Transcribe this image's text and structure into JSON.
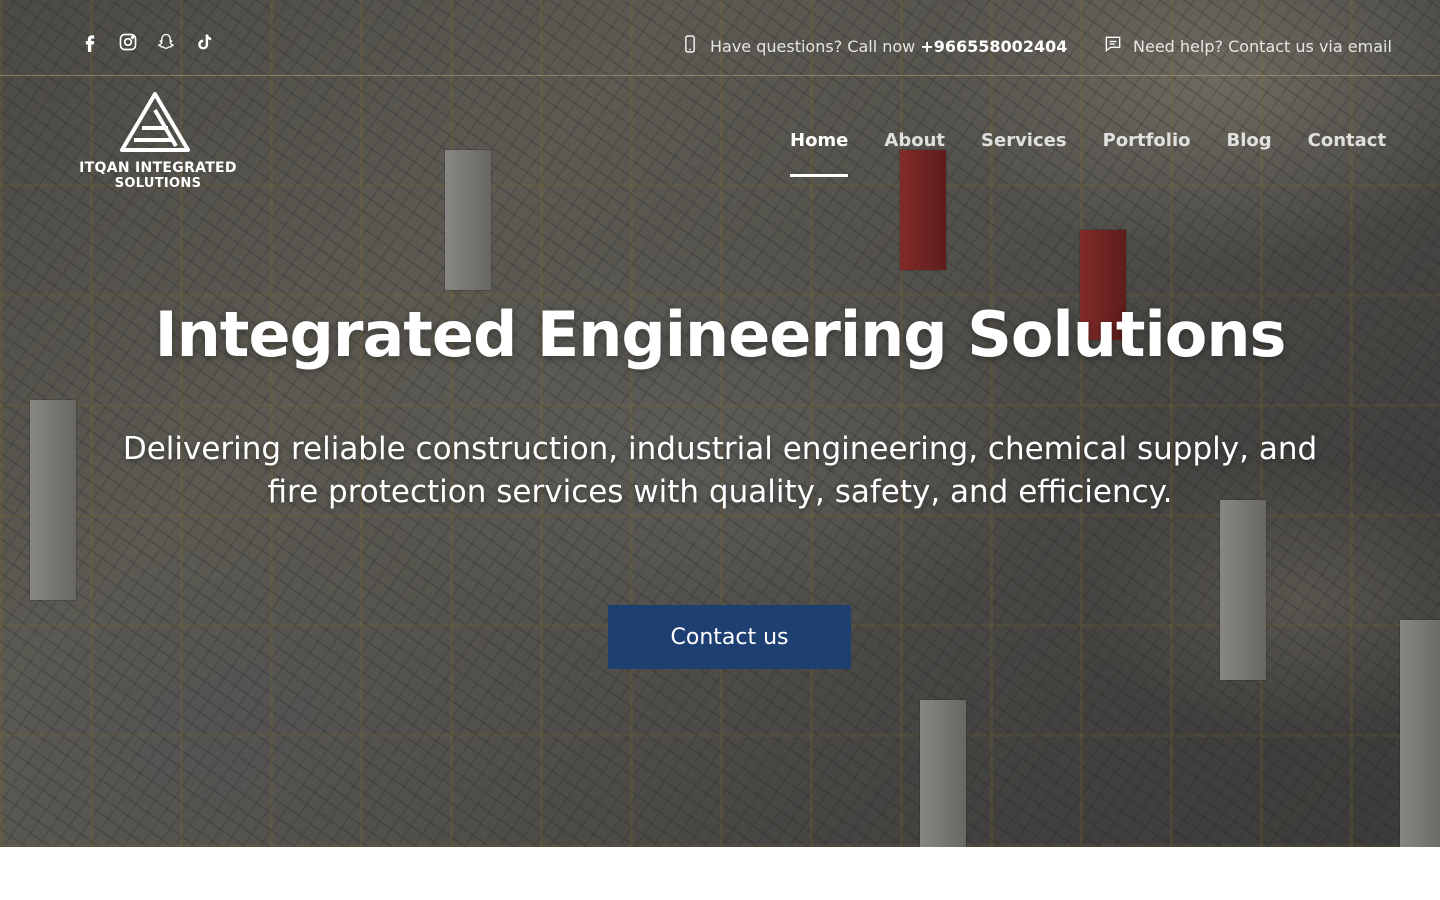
{
  "brand": {
    "name_line1": "ITQAN INTEGRATED",
    "name_line2": "SOLUTIONS",
    "icon": "triangle-logo-icon"
  },
  "topbar": {
    "social": [
      {
        "name": "facebook",
        "icon": "facebook-icon"
      },
      {
        "name": "instagram",
        "icon": "instagram-icon"
      },
      {
        "name": "snapchat",
        "icon": "snapchat-icon"
      },
      {
        "name": "tiktok",
        "icon": "tiktok-icon"
      }
    ],
    "phone": {
      "icon": "mobile-phone-icon",
      "label": "Have questions? Call now",
      "number": "+966558002404"
    },
    "email": {
      "icon": "chat-icon",
      "label": "Need help? Contact us via email"
    }
  },
  "nav": {
    "items": [
      {
        "label": "Home",
        "active": true
      },
      {
        "label": "About",
        "active": false
      },
      {
        "label": "Services",
        "active": false
      },
      {
        "label": "Portfolio",
        "active": false
      },
      {
        "label": "Blog",
        "active": false
      },
      {
        "label": "Contact",
        "active": false
      }
    ]
  },
  "hero": {
    "title": "Integrated Engineering Solutions",
    "subtitle": "Delivering reliable construction, industrial engineering, chemical supply, and fire protection services with quality, safety, and efficiency.",
    "cta_label": "Contact us",
    "cta_color": "#1e3f72"
  }
}
